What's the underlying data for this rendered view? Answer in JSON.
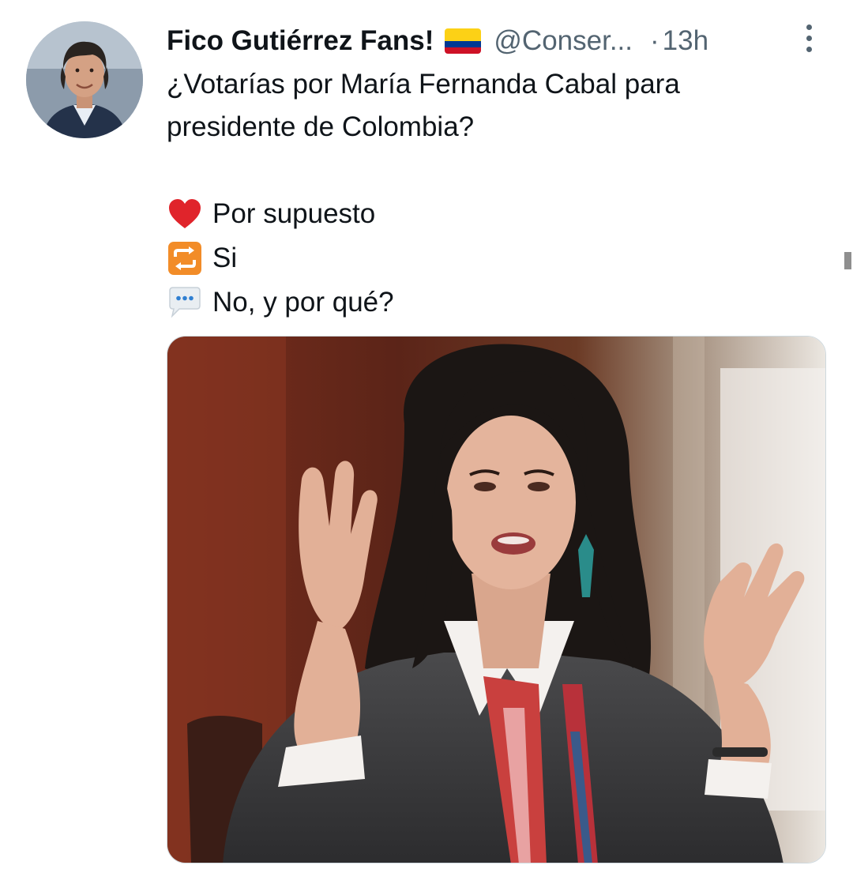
{
  "tweet": {
    "author": {
      "display_name": "Fico Gutiérrez Fans!",
      "handle": "@Conser...",
      "flag": "colombia-flag",
      "avatar": "avatar"
    },
    "separator": "·",
    "timestamp": "13h",
    "text_lines": [
      "¿Votarías por María Fernanda Cabal para",
      "presidente de Colombia?"
    ],
    "options": [
      {
        "icon": "red-heart-icon",
        "label": "Por supuesto"
      },
      {
        "icon": "repeat-icon",
        "label": "Si"
      },
      {
        "icon": "speech-bubble-icon",
        "label": "No, y por qué?"
      }
    ],
    "more_menu_icon": "more-vertical-icon",
    "media": {
      "kind": "photo"
    }
  },
  "colors": {
    "text": "#0f1419",
    "secondary": "#536471",
    "background": "#ffffff",
    "heart": "#e0242b",
    "repeat": "#f28c28",
    "flag_yellow": "#fcd116",
    "flag_blue": "#003893",
    "flag_red": "#ce1126"
  }
}
